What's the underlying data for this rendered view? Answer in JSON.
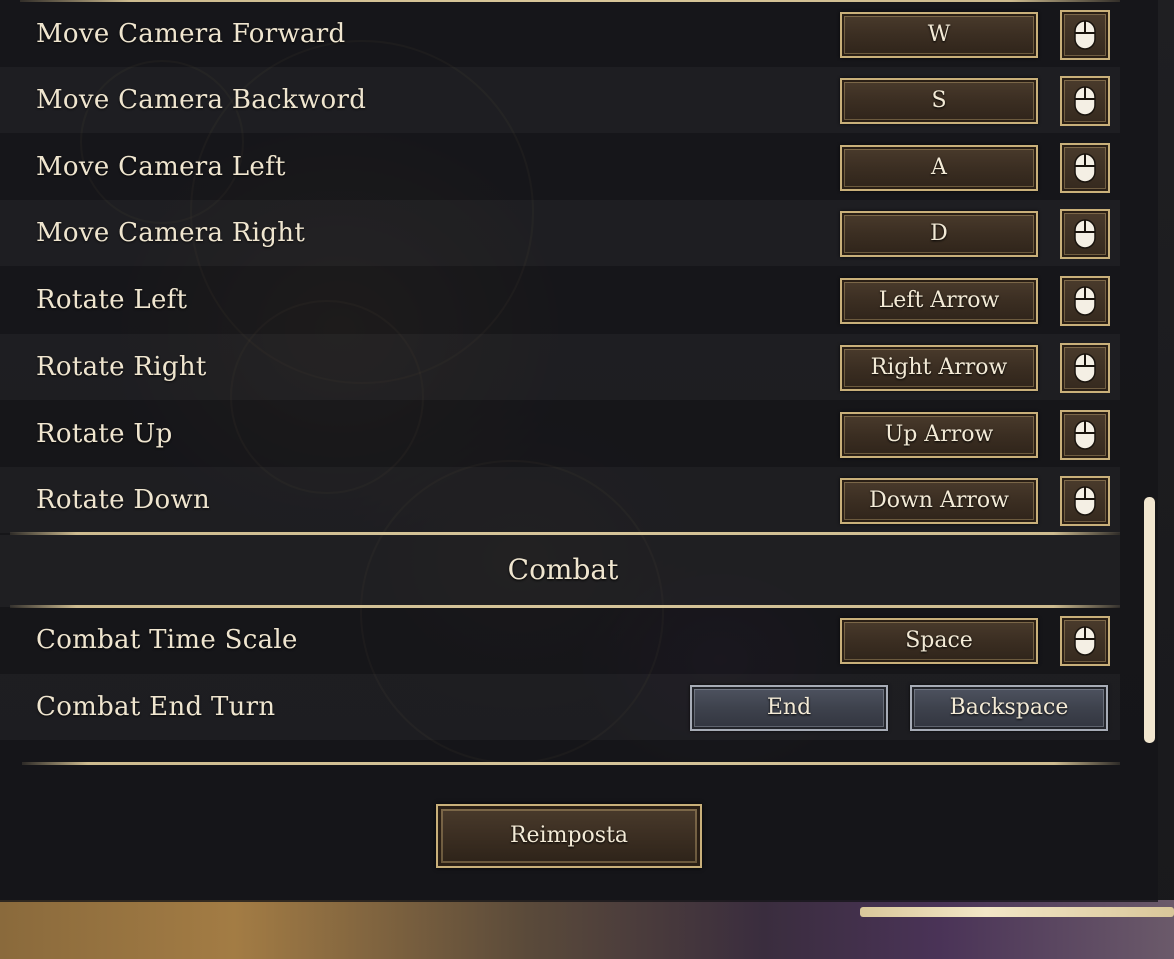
{
  "bindings": [
    {
      "action": "Move Camera Forward",
      "key": "W"
    },
    {
      "action": "Move Camera Backword",
      "key": "S"
    },
    {
      "action": "Move Camera Left",
      "key": "A"
    },
    {
      "action": "Move Camera Right",
      "key": "D"
    },
    {
      "action": "Rotate Left",
      "key": "Left Arrow"
    },
    {
      "action": "Rotate Right",
      "key": "Right Arrow"
    },
    {
      "action": "Rotate Up",
      "key": "Up Arrow"
    },
    {
      "action": "Rotate Down",
      "key": "Down Arrow"
    }
  ],
  "combat": {
    "title": "Combat",
    "time_scale": {
      "action": "Combat Time Scale",
      "key": "Space"
    },
    "end_turn": {
      "action": "Combat End Turn",
      "key_primary": "End",
      "key_secondary": "Backspace"
    }
  },
  "reset_label": "Reimposta",
  "icons": {
    "mouse": "mouse-icon"
  },
  "colors": {
    "gold_border": "#c9b07a",
    "text": "#efe5cf",
    "scroll_thumb": "#f1e6cf"
  }
}
